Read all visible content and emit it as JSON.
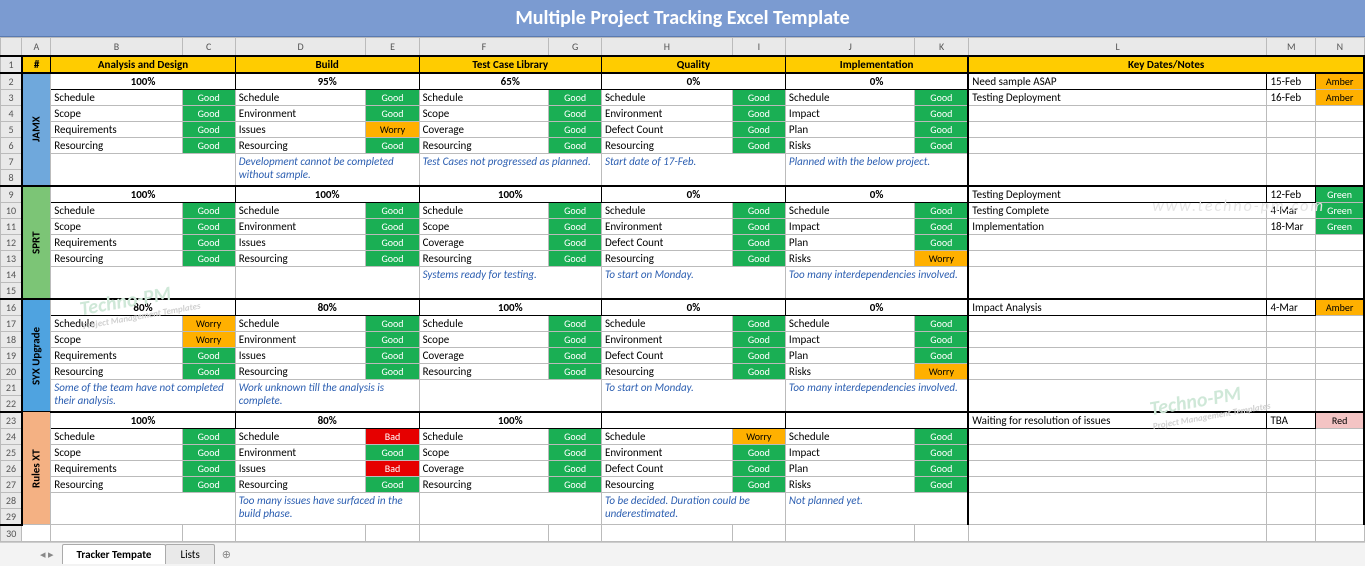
{
  "title": "Multiple Project Tracking Excel Template",
  "columns": [
    "A",
    "B",
    "C",
    "D",
    "E",
    "F",
    "G",
    "H",
    "I",
    "J",
    "K",
    "L",
    "M",
    "N"
  ],
  "row_numbers": [
    1,
    2,
    3,
    4,
    5,
    6,
    7,
    8,
    9,
    10,
    11,
    12,
    13,
    14,
    15,
    16,
    17,
    18,
    19,
    20,
    21,
    22,
    23,
    24,
    25,
    26,
    27,
    28,
    29
  ],
  "header": {
    "hash": "#",
    "cat1": "Analysis and Design",
    "cat2": "Build",
    "cat3": "Test Case Library",
    "cat4": "Quality",
    "cat5": "Implementation",
    "cat6": "Key Dates/Notes"
  },
  "item_labels": [
    "Schedule",
    "Scope",
    "Requirements",
    "Resourcing"
  ],
  "build_labels": [
    "Schedule",
    "Environment",
    "Issues",
    "Resourcing"
  ],
  "test_labels": [
    "Schedule",
    "Scope",
    "Coverage",
    "Resourcing"
  ],
  "qual_labels": [
    "Schedule",
    "Environment",
    "Defect Count",
    "Resourcing"
  ],
  "impl_labels": [
    "Schedule",
    "Impact",
    "Plan",
    "Risks"
  ],
  "projects": [
    {
      "name": "JAMX",
      "color": "pv-blue",
      "pct": [
        "100%",
        "95%",
        "65%",
        "0%",
        "0%"
      ],
      "st": [
        [
          "Good",
          "Good",
          "Good",
          "Good"
        ],
        [
          "Good",
          "Good",
          "Worry",
          "Good"
        ],
        [
          "Good",
          "Good",
          "Good",
          "Good"
        ],
        [
          "Good",
          "Good",
          "Good",
          "Good"
        ],
        [
          "Good",
          "Good",
          "Good",
          "Good"
        ]
      ],
      "notes": [
        "",
        "Development cannot be completed without sample.",
        "Test Cases not progressed as planned.",
        "Start date of 17-Feb.",
        "Planned with the below project."
      ],
      "kd": [
        [
          "Need sample ASAP",
          "15-Feb",
          "Amber"
        ],
        [
          "Testing Deployment",
          "16-Feb",
          "Amber"
        ],
        [
          "",
          "",
          ""
        ],
        [
          "",
          "",
          ""
        ],
        [
          "",
          "",
          ""
        ]
      ]
    },
    {
      "name": "SPRT",
      "color": "pv-green",
      "pct": [
        "100%",
        "100%",
        "100%",
        "0%",
        "0%"
      ],
      "st": [
        [
          "Good",
          "Good",
          "Good",
          "Good"
        ],
        [
          "Good",
          "Good",
          "Good",
          "Good"
        ],
        [
          "Good",
          "Good",
          "Good",
          "Good"
        ],
        [
          "Good",
          "Good",
          "Good",
          "Good"
        ],
        [
          "Good",
          "Good",
          "Good",
          "Worry"
        ]
      ],
      "notes": [
        "",
        "",
        "Systems ready for testing.",
        "To start on Monday.",
        "Too many interdependencies involved."
      ],
      "kd": [
        [
          "Testing Deployment",
          "12-Feb",
          "Green"
        ],
        [
          "Testing Complete",
          "4-Mar",
          "Green"
        ],
        [
          "Implementation",
          "18-Mar",
          "Green"
        ],
        [
          "",
          "",
          ""
        ],
        [
          "",
          "",
          ""
        ]
      ]
    },
    {
      "name": "SYX Upgrade",
      "color": "pv-azure",
      "pct": [
        "80%",
        "80%",
        "100%",
        "0%",
        "0%"
      ],
      "st": [
        [
          "Worry",
          "Worry",
          "Good",
          "Good"
        ],
        [
          "Good",
          "Good",
          "Good",
          "Good"
        ],
        [
          "Good",
          "Good",
          "Good",
          "Good"
        ],
        [
          "Good",
          "Good",
          "Good",
          "Good"
        ],
        [
          "Good",
          "Good",
          "Good",
          "Worry"
        ]
      ],
      "notes": [
        "Some of the team have not completed their analysis.",
        "Work unknown till the analysis is complete.",
        "",
        "To start on Monday.",
        "Too many interdependencies involved."
      ],
      "kd": [
        [
          "Impact Analysis",
          "4-Mar",
          "Amber"
        ],
        [
          "",
          "",
          ""
        ],
        [
          "",
          "",
          ""
        ],
        [
          "",
          "",
          ""
        ],
        [
          "",
          "",
          ""
        ]
      ]
    },
    {
      "name": "Rules XT",
      "color": "pv-orange",
      "pct": [
        "100%",
        "80%",
        "100%",
        "",
        ""
      ],
      "st": [
        [
          "Good",
          "Good",
          "Good",
          "Good"
        ],
        [
          "Bad",
          "Good",
          "Bad",
          "Good"
        ],
        [
          "Good",
          "Good",
          "Good",
          "Good"
        ],
        [
          "Worry",
          "Good",
          "Good",
          "Good"
        ],
        [
          "Good",
          "Good",
          "Good",
          "Good"
        ]
      ],
      "notes": [
        "",
        "Too many issues have surfaced in the build phase.",
        "",
        "To be decided. Duration could be underestimated.",
        "Not planned yet."
      ],
      "kd": [
        [
          "Waiting for resolution of issues",
          "TBA",
          "Red"
        ],
        [
          "",
          "",
          ""
        ],
        [
          "",
          "",
          ""
        ],
        [
          "",
          "",
          ""
        ],
        [
          "",
          "",
          ""
        ]
      ]
    }
  ],
  "tabs": {
    "active": "Tracker Tempate",
    "other": "Lists"
  },
  "watermark": {
    "brand": "Techno-PM",
    "sub": "Project Management Templates",
    "url": "www.techno-pm.com"
  }
}
